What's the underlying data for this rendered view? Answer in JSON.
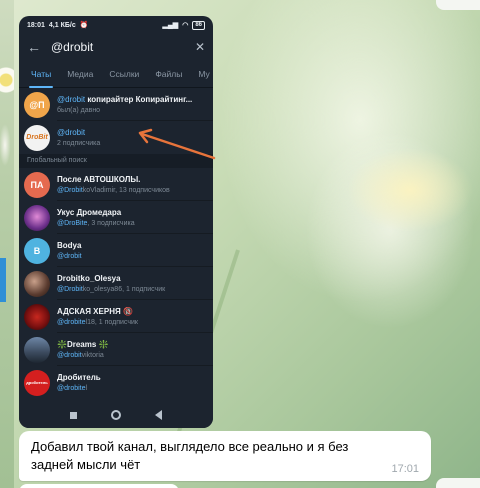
{
  "status_bar": {
    "time": "18:01",
    "speed": "4,1 КБ/с",
    "alarm_icon": "alarm-icon",
    "battery": "86"
  },
  "search": {
    "query": "@drobit",
    "back_icon": "arrow-left-icon",
    "close_icon": "close-icon"
  },
  "tabs": [
    {
      "label": "Чаты",
      "active": true
    },
    {
      "label": "Медиа",
      "active": false
    },
    {
      "label": "Ссылки",
      "active": false
    },
    {
      "label": "Файлы",
      "active": false
    },
    {
      "label": "Му",
      "active": false
    }
  ],
  "chats": [
    {
      "avatar_text": "@П",
      "avatar_color": "#f0a54a",
      "title_highlight": "@drobit",
      "title_rest": " копирайтер Копирайтинг...",
      "subtitle": "был(а) давно"
    },
    {
      "avatar_text": "DroBit",
      "avatar_color": "#f2f2f2",
      "title_highlight": "@drobit",
      "title_rest": "",
      "subtitle": "2 подписчика"
    }
  ],
  "global_section_label": "Глобальный поиск",
  "global_results": [
    {
      "avatar_text": "ПА",
      "avatar_color": "#e56a4f",
      "title": "После АВТОШКОЛЫ.",
      "sub_highlight": "@Drobit",
      "sub_rest": "koVladimir, 13 подписчиков"
    },
    {
      "avatar_text": "",
      "avatar_color": "#6b2f8a",
      "title": "Укус Дромедара",
      "sub_highlight": "@DroBite",
      "sub_rest": ", 3 подписчика"
    },
    {
      "avatar_text": "B",
      "avatar_color": "#4fb3e0",
      "title": "Bodya",
      "sub_highlight": "@drobit",
      "sub_rest": ""
    },
    {
      "avatar_text": "",
      "avatar_color": "#5a3b2f",
      "title": "Drobitko_Olesya",
      "sub_highlight": "@Drobit",
      "sub_rest": "ko_olesya86, 1 подписчик"
    },
    {
      "avatar_text": "",
      "avatar_color": "#7a1010",
      "title": "АДСКАЯ ХЕРНЯ 🔞",
      "sub_highlight": "@drobite",
      "sub_rest": "l18, 1 подписчик"
    },
    {
      "avatar_text": "",
      "avatar_color": "#3b4a5e",
      "title": "❇️Dreams ❇️",
      "sub_highlight": "@drobit",
      "sub_rest": "viktoria"
    },
    {
      "avatar_text": "дробитель",
      "avatar_color": "#d41f1f",
      "title": "Дробитель",
      "sub_highlight": "@drobite",
      "sub_rest": "l"
    }
  ],
  "navbar": {
    "recents_icon": "square-icon",
    "home_icon": "circle-icon",
    "back_icon": "triangle-back-icon"
  },
  "annotation": {
    "arrow_color": "#e8743b"
  },
  "message": {
    "text": "Добавил твой канал, выглядело все реально и я без задней мысли чёт",
    "time": "17:01"
  }
}
